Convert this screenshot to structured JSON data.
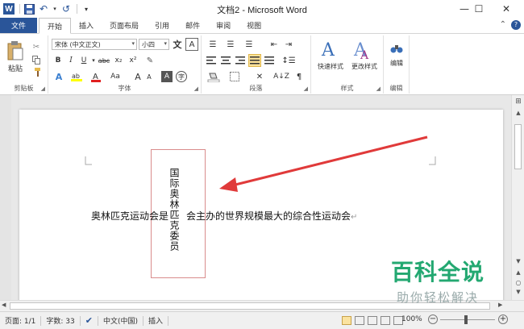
{
  "window": {
    "title": "文档2 - Microsoft Word",
    "minimize": "—",
    "maximize": "☐",
    "close": "✕"
  },
  "qat": {
    "undo": "↶",
    "redo": "↺",
    "customize": "▾"
  },
  "tabs": [
    "文件",
    "开始",
    "插入",
    "页面布局",
    "引用",
    "邮件",
    "审阅",
    "视图"
  ],
  "tab_icons": {
    "help": "?",
    "collapse": "⌃"
  },
  "clipboard": {
    "label": "剪贴板",
    "paste": "粘贴"
  },
  "font": {
    "label": "字体",
    "name": "宋体 (中文正文)",
    "size": "小四",
    "bold": "B",
    "italic": "I",
    "underline": "U",
    "strike": "abc",
    "subscript": "x₂",
    "superscript": "x²",
    "grow": "A",
    "shrink": "A",
    "case": "Aa",
    "clear": "A",
    "phonetic": "文"
  },
  "paragraph": {
    "label": "段落"
  },
  "styles": {
    "label": "样式",
    "quick": "快速样式",
    "change": "更改样式"
  },
  "editing": {
    "label": "编辑",
    "edit": "编辑"
  },
  "document": {
    "textbox_text": "国际奥林匹克委员",
    "body_text": "奥林匹克运动会是",
    "body_text_after": "会主办的世界规模最大的综合性运动会",
    "para_mark": "↵"
  },
  "status": {
    "page": "页面: 1/1",
    "words": "字数: 33",
    "language": "中文(中国)",
    "mode": "插入",
    "zoom": "100%"
  },
  "watermark": {
    "title": "百科全说",
    "subtitle": "助你轻松解决"
  },
  "colors": {
    "file_tab": "#2a5599",
    "arrow": "#e03a3a",
    "textbox_border": "#d98c8c",
    "watermark": "#23a871"
  }
}
